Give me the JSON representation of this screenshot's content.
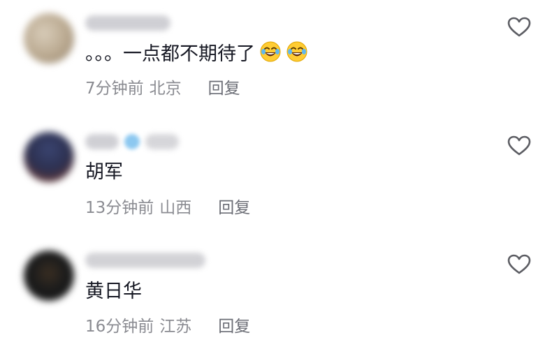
{
  "comments": [
    {
      "content": "。。。一点都不期待了",
      "emoji_count": 2,
      "emoji_icon": "tears-of-joy-emoji",
      "time": "7分钟前",
      "location": "北京",
      "reply_label": "回复",
      "avatar_colors": [
        "#c9bca8",
        "#9f8f7a"
      ]
    },
    {
      "content": "胡军",
      "emoji_count": 0,
      "time": "13分钟前",
      "location": "山西",
      "reply_label": "回复",
      "avatar_colors": [
        "#2d3553",
        "#6a3c3a"
      ]
    },
    {
      "content": "黄日华",
      "emoji_count": 0,
      "time": "16分钟前",
      "location": "江苏",
      "reply_label": "回复",
      "avatar_colors": [
        "#1a1a1a",
        "#6a5a3c"
      ]
    }
  ],
  "icons": {
    "like": "heart-outline-icon",
    "emoji": "tears-of-joy-emoji"
  },
  "colors": {
    "text": "#161823",
    "meta": "#8a8b91",
    "icon": "#5c5d63",
    "verified_badge": "#8cc8f0"
  }
}
